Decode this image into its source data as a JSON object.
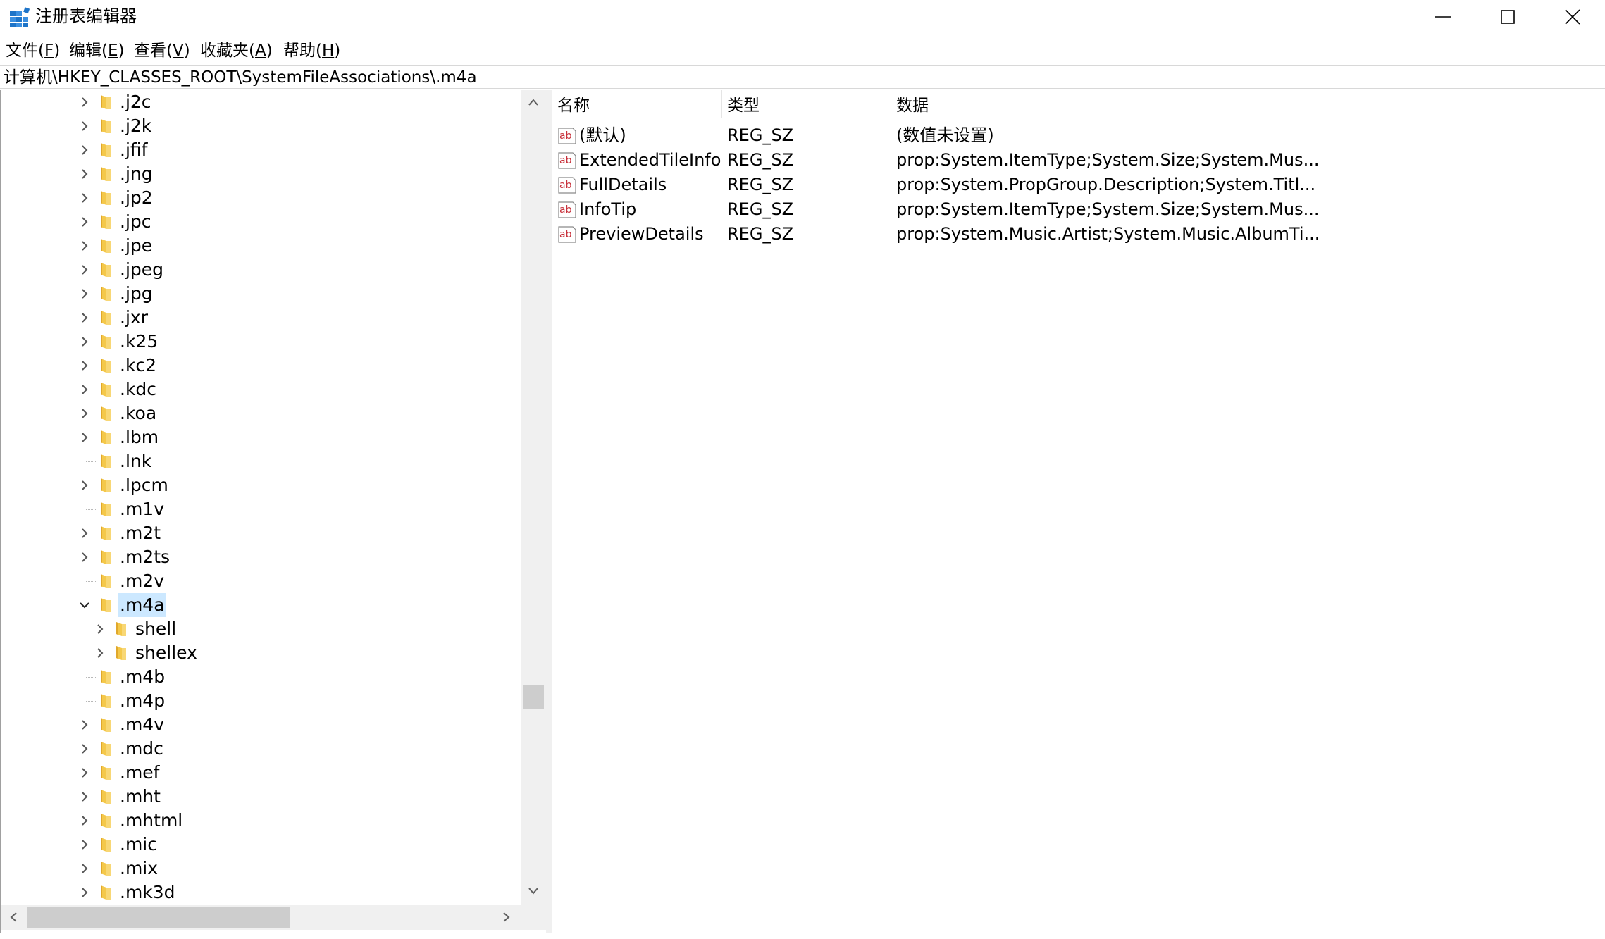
{
  "window": {
    "title": "注册表编辑器",
    "app_icon": "registry-editor-icon"
  },
  "menu": {
    "items": [
      {
        "label": "文件(",
        "acc": "F",
        "end": ")"
      },
      {
        "label": "编辑(",
        "acc": "E",
        "end": ")"
      },
      {
        "label": "查看(",
        "acc": "V",
        "end": ")"
      },
      {
        "label": "收藏夹(",
        "acc": "A",
        "end": ")"
      },
      {
        "label": "帮助(",
        "acc": "H",
        "end": ")"
      }
    ]
  },
  "address": {
    "path": "计算机\\HKEY_CLASSES_ROOT\\SystemFileAssociations\\.m4a"
  },
  "tree": {
    "items": [
      {
        "label": ".j2c",
        "expandable": true,
        "depth": 0
      },
      {
        "label": ".j2k",
        "expandable": true,
        "depth": 0
      },
      {
        "label": ".jfif",
        "expandable": true,
        "depth": 0
      },
      {
        "label": ".jng",
        "expandable": true,
        "depth": 0
      },
      {
        "label": ".jp2",
        "expandable": true,
        "depth": 0
      },
      {
        "label": ".jpc",
        "expandable": true,
        "depth": 0
      },
      {
        "label": ".jpe",
        "expandable": true,
        "depth": 0
      },
      {
        "label": ".jpeg",
        "expandable": true,
        "depth": 0
      },
      {
        "label": ".jpg",
        "expandable": true,
        "depth": 0
      },
      {
        "label": ".jxr",
        "expandable": true,
        "depth": 0
      },
      {
        "label": ".k25",
        "expandable": true,
        "depth": 0
      },
      {
        "label": ".kc2",
        "expandable": true,
        "depth": 0
      },
      {
        "label": ".kdc",
        "expandable": true,
        "depth": 0
      },
      {
        "label": ".koa",
        "expandable": true,
        "depth": 0
      },
      {
        "label": ".lbm",
        "expandable": true,
        "depth": 0
      },
      {
        "label": ".lnk",
        "expandable": false,
        "depth": 0
      },
      {
        "label": ".lpcm",
        "expandable": true,
        "depth": 0
      },
      {
        "label": ".m1v",
        "expandable": false,
        "depth": 0
      },
      {
        "label": ".m2t",
        "expandable": true,
        "depth": 0
      },
      {
        "label": ".m2ts",
        "expandable": true,
        "depth": 0
      },
      {
        "label": ".m2v",
        "expandable": false,
        "depth": 0
      },
      {
        "label": ".m4a",
        "expandable": true,
        "expanded": true,
        "selected": true,
        "depth": 0
      },
      {
        "label": "shell",
        "expandable": true,
        "depth": 1
      },
      {
        "label": "shellex",
        "expandable": true,
        "depth": 1
      },
      {
        "label": ".m4b",
        "expandable": false,
        "depth": 0
      },
      {
        "label": ".m4p",
        "expandable": false,
        "depth": 0
      },
      {
        "label": ".m4v",
        "expandable": true,
        "depth": 0
      },
      {
        "label": ".mdc",
        "expandable": true,
        "depth": 0
      },
      {
        "label": ".mef",
        "expandable": true,
        "depth": 0
      },
      {
        "label": ".mht",
        "expandable": true,
        "depth": 0
      },
      {
        "label": ".mhtml",
        "expandable": true,
        "depth": 0
      },
      {
        "label": ".mic",
        "expandable": true,
        "depth": 0
      },
      {
        "label": ".mix",
        "expandable": true,
        "depth": 0
      },
      {
        "label": ".mk3d",
        "expandable": true,
        "depth": 0
      }
    ]
  },
  "list": {
    "columns": {
      "name": "名称",
      "type": "类型",
      "data": "数据"
    },
    "rows": [
      {
        "name": "(默认)",
        "type": "REG_SZ",
        "data": "(数值未设置)"
      },
      {
        "name": "ExtendedTileInfo",
        "type": "REG_SZ",
        "data": "prop:System.ItemType;System.Size;System.Mus..."
      },
      {
        "name": "FullDetails",
        "type": "REG_SZ",
        "data": "prop:System.PropGroup.Description;System.Titl..."
      },
      {
        "name": "InfoTip",
        "type": "REG_SZ",
        "data": "prop:System.ItemType;System.Size;System.Mus..."
      },
      {
        "name": "PreviewDetails",
        "type": "REG_SZ",
        "data": "prop:System.Music.Artist;System.Music.AlbumTi..."
      }
    ]
  },
  "colors": {
    "selection": "#cce8ff",
    "folder": "#f4c84a",
    "ab_icon": "#c8323c",
    "scrollbar_track": "#f0f0f0",
    "scrollbar_thumb": "#cdcdcd"
  }
}
